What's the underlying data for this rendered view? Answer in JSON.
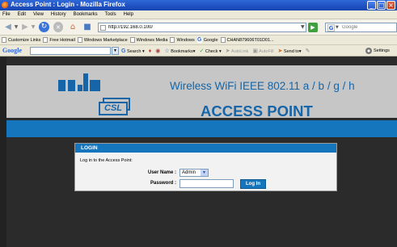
{
  "window": {
    "title": "Access Point : Login - Mozilla Firefox",
    "min_glyph": "_",
    "max_glyph": "□",
    "close_glyph": "×"
  },
  "menu": [
    "File",
    "Edit",
    "View",
    "History",
    "Bookmarks",
    "Tools",
    "Help"
  ],
  "navbar": {
    "url": "http://192.168.0.100/",
    "search_placeholder": "Google"
  },
  "links": [
    "Customize Links",
    "Free Hotmail",
    "Windows Marketplace",
    "Windows Media",
    "Windows",
    "Google",
    "CHAN879606T01D01..."
  ],
  "google_toolbar": {
    "logo": "Google",
    "search_label": "Search",
    "bookmarks_label": "Bookmarks",
    "check_label": "Check",
    "autolink_label": "AutoLink",
    "autofill_label": "AutoFill",
    "sendto_label": "Send to",
    "settings_label": "Settings"
  },
  "banner": {
    "wifi_text": "Wireless WiFi IEEE 802.11 a / b / g / h",
    "ap_text": "ACCESS POINT",
    "logo_text": "CSL",
    "brand_color": "#1565a8"
  },
  "login": {
    "header": "LOGIN",
    "instruction": "Log in to the Access Point:",
    "username_label": "User Name :",
    "username_value": "Admin",
    "password_label": "Password :",
    "password_value": "",
    "button_label": "Log In"
  }
}
